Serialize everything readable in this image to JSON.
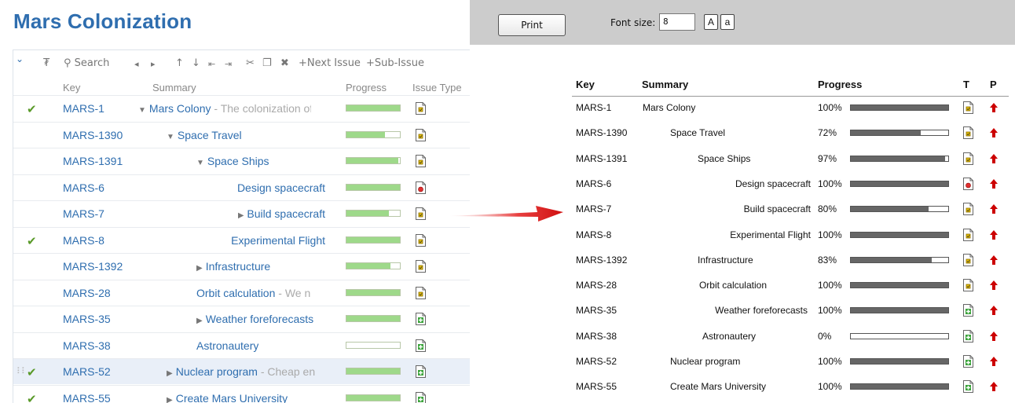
{
  "app": {
    "title": "Mars Colonization"
  },
  "toolbar": {
    "search_label": "Search",
    "next_issue_label": "+Next Issue",
    "sub_issue_label": "+Sub-Issue"
  },
  "columns": {
    "key": "Key",
    "summary": "Summary",
    "progress": "Progress",
    "issue_type": "Issue Type"
  },
  "rows": [
    {
      "key": "MARS-1",
      "summary": "Mars Colony",
      "desc": " - The colonization of",
      "expander": "down",
      "done": true,
      "progress": 1.0,
      "type": "task",
      "indent": 0
    },
    {
      "key": "MARS-1390",
      "summary": "Space Travel",
      "desc": "",
      "expander": "down",
      "done": false,
      "progress": 0.72,
      "type": "task",
      "indent": 1
    },
    {
      "key": "MARS-1391",
      "summary": "Space Ships",
      "desc": "",
      "expander": "down",
      "done": false,
      "progress": 0.97,
      "type": "task",
      "indent": 2
    },
    {
      "key": "MARS-6",
      "summary": "Design spacecraft",
      "desc": "",
      "expander": "none",
      "done": false,
      "progress": 1.0,
      "type": "bug",
      "indent": 3
    },
    {
      "key": "MARS-7",
      "summary": "Build spacecraft",
      "desc": "",
      "expander": "right",
      "done": false,
      "progress": 0.8,
      "type": "task",
      "indent": 3
    },
    {
      "key": "MARS-8",
      "summary": "Experimental Flight",
      "desc": "",
      "expander": "none",
      "done": true,
      "progress": 1.0,
      "type": "task",
      "indent": 3
    },
    {
      "key": "MARS-1392",
      "summary": "Infrastructure",
      "desc": "",
      "expander": "right",
      "done": false,
      "progress": 0.83,
      "type": "task",
      "indent": 2
    },
    {
      "key": "MARS-28",
      "summary": "Orbit calculation",
      "desc": " - We n",
      "expander": "none",
      "done": false,
      "progress": 1.0,
      "type": "task",
      "indent": 2
    },
    {
      "key": "MARS-35",
      "summary": "Weather foreforecasts",
      "desc": "",
      "expander": "right",
      "done": false,
      "progress": 1.0,
      "type": "feature",
      "indent": 2
    },
    {
      "key": "MARS-38",
      "summary": "Astronautery",
      "desc": "",
      "expander": "none",
      "done": false,
      "progress": 0.0,
      "type": "feature",
      "indent": 2
    },
    {
      "key": "MARS-52",
      "summary": "Nuclear program",
      "desc": " - Cheap en",
      "expander": "right",
      "done": true,
      "progress": 1.0,
      "type": "feature",
      "indent": 1,
      "selected": true
    },
    {
      "key": "MARS-55",
      "summary": "Create Mars University",
      "desc": "",
      "expander": "right",
      "done": true,
      "progress": 1.0,
      "type": "feature",
      "indent": 1
    }
  ],
  "print_view": {
    "print_label": "Print",
    "font_size_label": "Font size:",
    "font_size_value": "8",
    "larger_label": "A",
    "smaller_label": "a",
    "headers": {
      "key": "Key",
      "summary": "Summary",
      "progress": "Progress",
      "type": "T",
      "priority": "P"
    },
    "rows": [
      {
        "key": "MARS-1",
        "summary": "Mars Colony",
        "pct": "100%",
        "progress": 1.0,
        "type": "task"
      },
      {
        "key": "MARS-1390",
        "summary": "Space Travel",
        "pct": "72%",
        "progress": 0.72,
        "type": "task"
      },
      {
        "key": "MARS-1391",
        "summary": "Space Ships",
        "pct": "97%",
        "progress": 0.97,
        "type": "task"
      },
      {
        "key": "MARS-6",
        "summary": "Design spacecraft",
        "pct": "100%",
        "progress": 1.0,
        "type": "bug"
      },
      {
        "key": "MARS-7",
        "summary": "Build spacecraft",
        "pct": "80%",
        "progress": 0.8,
        "type": "task"
      },
      {
        "key": "MARS-8",
        "summary": "Experimental Flight",
        "pct": "100%",
        "progress": 1.0,
        "type": "task"
      },
      {
        "key": "MARS-1392",
        "summary": "Infrastructure",
        "pct": "83%",
        "progress": 0.83,
        "type": "task"
      },
      {
        "key": "MARS-28",
        "summary": "Orbit calculation",
        "pct": "100%",
        "progress": 1.0,
        "type": "task"
      },
      {
        "key": "MARS-35",
        "summary": "Weather foreforecasts",
        "pct": "100%",
        "progress": 1.0,
        "type": "feature"
      },
      {
        "key": "MARS-38",
        "summary": "Astronautery",
        "pct": "0%",
        "progress": 0.0,
        "type": "feature"
      },
      {
        "key": "MARS-52",
        "summary": "Nuclear program",
        "pct": "100%",
        "progress": 1.0,
        "type": "feature"
      },
      {
        "key": "MARS-55",
        "summary": "Create Mars University",
        "pct": "100%",
        "progress": 1.0,
        "type": "feature"
      }
    ]
  },
  "colors": {
    "link": "#2f6eaf",
    "progress_fill": "#9ed98a",
    "print_fill": "#666666",
    "done_check": "#5a9a2a",
    "arrow": "#e02020",
    "priority": "#cc0000"
  }
}
